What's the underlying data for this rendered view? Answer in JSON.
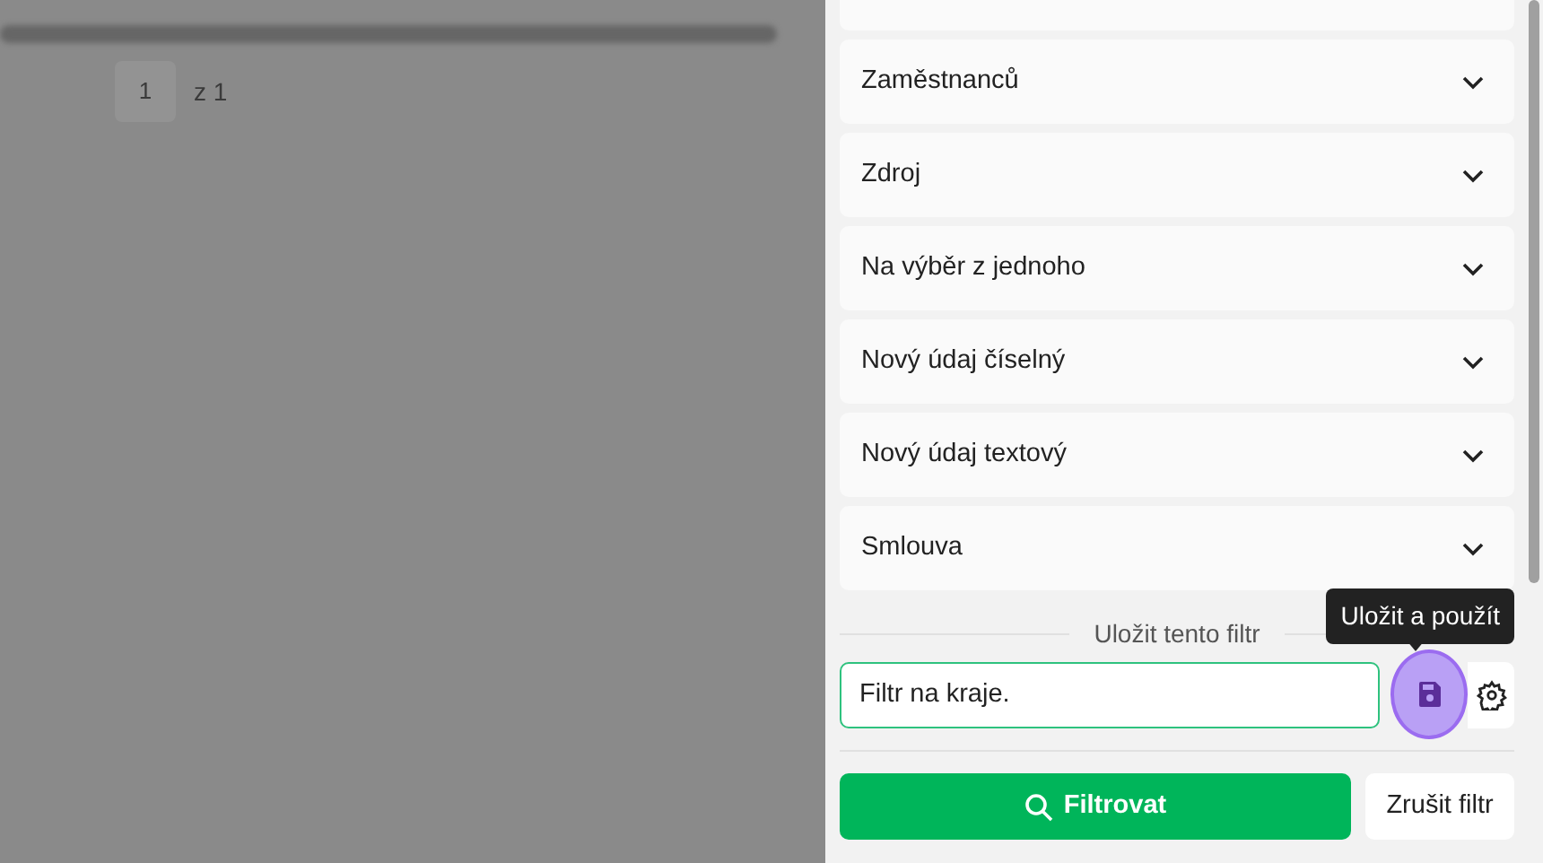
{
  "background": {
    "pagination": {
      "current": "1",
      "total": "z 1"
    }
  },
  "filters": [
    {
      "expanded": false
    },
    {
      "label": "Zaměstnanců",
      "expanded": false
    },
    {
      "label": "Zdroj",
      "expanded": false
    },
    {
      "label": "Na výběr z jednoho",
      "expanded": false
    },
    {
      "label": "Nový údaj číselný",
      "expanded": false
    },
    {
      "label": "Nový údaj textový",
      "expanded": false
    },
    {
      "label": "Smlouva",
      "expanded": false
    }
  ],
  "save_section": {
    "label": "Uložit tento filtr",
    "name_value": "Filtr na kraje.",
    "tooltip": "Uložit a použít"
  },
  "buttons": [
    {
      "kind": "primary",
      "label": "Filtrovat"
    },
    {
      "kind": "secondary",
      "label": "Zrušit filtr"
    }
  ]
}
